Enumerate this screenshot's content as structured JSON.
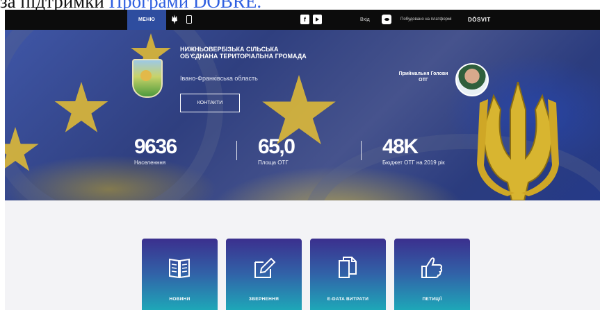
{
  "caption": {
    "prefix": "за підтримки ",
    "link": "Програми DOBRE."
  },
  "topbar": {
    "menu_label": "МЕНЮ",
    "login_label": "Вхід",
    "built_on_label": "Побудовано на платформі",
    "brand_label": "DŌSVIT",
    "icons": [
      "trident-icon",
      "phone-icon",
      "facebook-icon",
      "youtube-icon",
      "eye-icon"
    ]
  },
  "hero": {
    "community_name": "НИЖНЬОВЕРБІЗЬКА СІЛЬСЬКА ОБ'ЄДНАНА ТЕРИТОРІАЛЬНА ГРОМАДА",
    "region": "Івано-Франківська область",
    "contacts_button": "КОНТАКТИ",
    "reception_label": "Приймальня Голови ОТГ",
    "stats": [
      {
        "value": "9636",
        "label": "Населенння"
      },
      {
        "value": "65,0",
        "label": "Площа ОТГ"
      },
      {
        "value": "48K",
        "label": "Бюджет ОТГ на 2019 рік"
      }
    ]
  },
  "tiles": [
    {
      "label": "НОВИНИ",
      "icon": "book-icon"
    },
    {
      "label": "ЗВЕРНЕННЯ",
      "icon": "edit-icon"
    },
    {
      "label": "E-DATA ВИТРАТИ",
      "icon": "documents-icon"
    },
    {
      "label": "ПЕТИЦІЇ",
      "icon": "thumbs-up-icon"
    }
  ],
  "colors": {
    "topbar": "#0c0c0c",
    "menu_accent": "#2e4d9f",
    "tile_top": "#3b2f8e",
    "tile_bottom": "#1ea7b8",
    "page_bg": "#f3f3f6"
  }
}
